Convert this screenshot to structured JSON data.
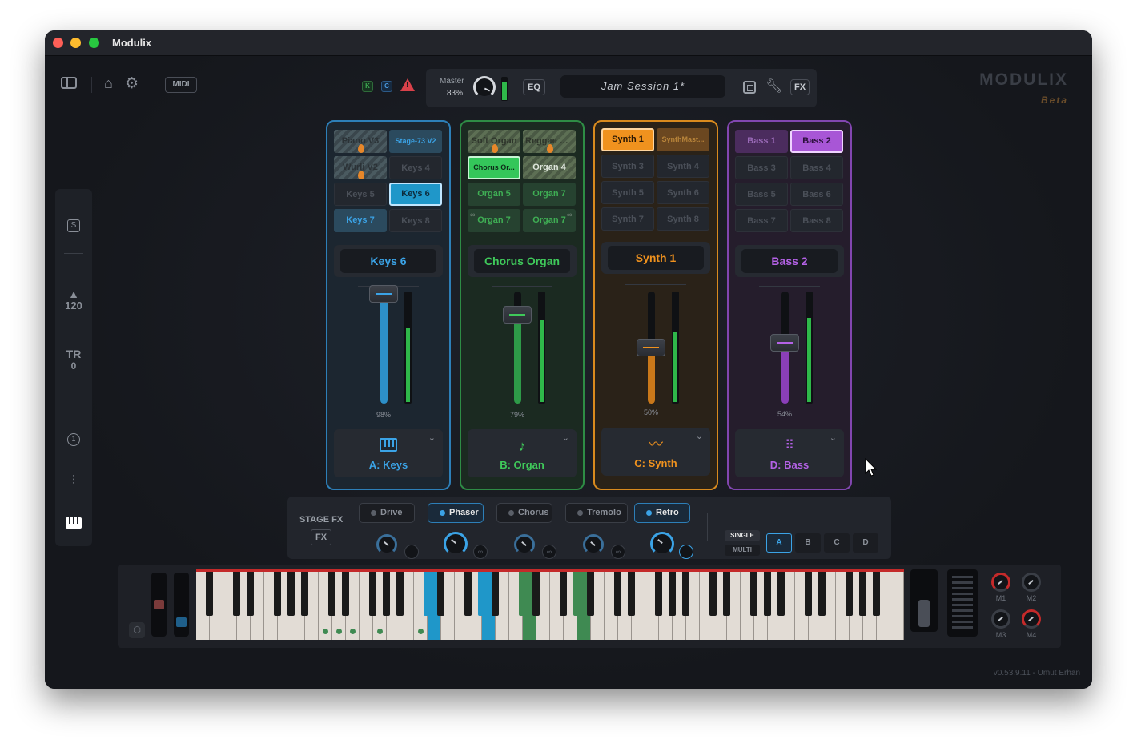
{
  "window": {
    "title": "Modulix"
  },
  "toolbar": {
    "midi_label": "MIDI",
    "indicator_k": "K",
    "indicator_c": "C",
    "warning_symbol": "!",
    "master_label": "Master",
    "master_value": "83%",
    "master_level": 0.83,
    "eq_label": "EQ",
    "session_name": "Jam Session 1*",
    "fx_label": "FX"
  },
  "brand": {
    "name": "MODULIX",
    "sub": "Beta"
  },
  "sidebar": {
    "s_label": "S",
    "tempo_value": "120",
    "tr_label": "TR",
    "tr_value": "0",
    "one_label": "1"
  },
  "channels": [
    {
      "id": "a",
      "color": "#3ba3e6",
      "presets": [
        "Piano V3",
        "Stage-73 V2",
        "Wurli V2",
        "Keys 4",
        "Keys 5",
        "Keys 6",
        "Keys 7",
        "Keys 8"
      ],
      "selected_preset": "Keys 6",
      "patch_name": "Keys 6",
      "fader_value": "98%",
      "fader_level": 0.98,
      "meter_level": 0.68,
      "bank_label": "A: Keys"
    },
    {
      "id": "b",
      "color": "#3fc85a",
      "presets": [
        "Soft Organ",
        "Reggae Or...",
        "Chorus Or...",
        "Organ 4",
        "Organ 5",
        "Organ 7",
        "Organ 7",
        "Organ 7"
      ],
      "selected_preset": "Chorus Or...",
      "patch_name": "Chorus Organ",
      "fader_value": "79%",
      "fader_level": 0.79,
      "meter_level": 0.75,
      "bank_label": "B: Organ"
    },
    {
      "id": "c",
      "color": "#f0921e",
      "presets": [
        "Synth 1",
        "SynthMast...",
        "Synth 3",
        "Synth 4",
        "Synth 5",
        "Synth 6",
        "Synth 7",
        "Synth 8"
      ],
      "selected_preset": "Synth 1",
      "patch_name": "Synth 1",
      "fader_value": "50%",
      "fader_level": 0.5,
      "meter_level": 0.65,
      "bank_label": "C: Synth"
    },
    {
      "id": "d",
      "color": "#b462e6",
      "presets": [
        "Bass 1",
        "Bass 2",
        "Bass 3",
        "Bass 4",
        "Bass 5",
        "Bass 6",
        "Bass 7",
        "Bass 8"
      ],
      "selected_preset": "Bass 2",
      "patch_name": "Bass 2",
      "fader_value": "54%",
      "fader_level": 0.54,
      "meter_level": 0.77,
      "bank_label": "D: Bass"
    }
  ],
  "stage_fx": {
    "title": "STAGE FX",
    "fx_button": "FX",
    "effects": [
      {
        "label": "Drive",
        "active": false
      },
      {
        "label": "Phaser",
        "active": true
      },
      {
        "label": "Chorus",
        "active": false
      },
      {
        "label": "Tremolo",
        "active": false
      },
      {
        "label": "Retro",
        "active": true
      }
    ],
    "mode_single": "SINGLE",
    "mode_multi": "MULTI",
    "targets": [
      "A",
      "B",
      "C",
      "D"
    ],
    "selected_target": "A"
  },
  "keyboard": {
    "mod_labels": [
      "M1",
      "M2",
      "M3",
      "M4"
    ]
  },
  "footer": {
    "version": "v0.53.9.11 - Umut Erhan"
  }
}
